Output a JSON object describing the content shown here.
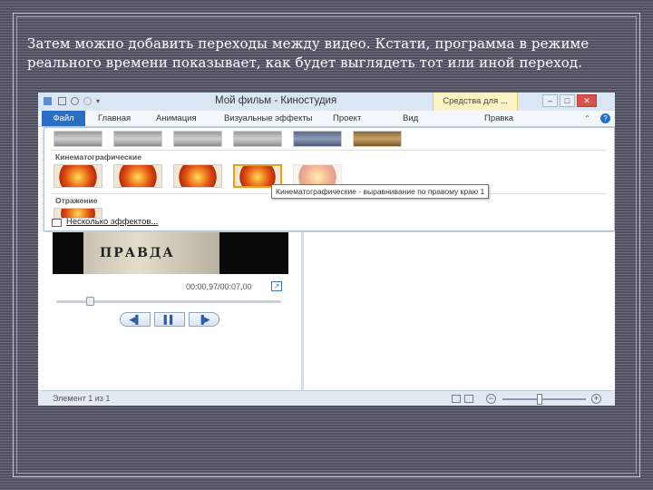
{
  "slide": {
    "caption": "Затем можно добавить переходы между видео. Кстати, программа в режиме реального времени показывает, как будет выглядеть тот или иной переход."
  },
  "window": {
    "title": "Мой фильм - Киностудия",
    "context_tab": "Средства для ...",
    "controls": {
      "minimize": "–",
      "maximize": "□",
      "close": "✕"
    }
  },
  "ribbon": {
    "tabs": [
      "Файл",
      "Главная",
      "Анимация",
      "Визуальные эффекты",
      "Проект",
      "Вид",
      "Правка"
    ],
    "help": "?"
  },
  "gallery": {
    "sections": [
      {
        "label": "Кинематографические"
      },
      {
        "label": "Отражение"
      }
    ],
    "tooltip": "Кинематографические - выравнивание по правому краю 1",
    "more_effects": "Несколько эффектов..."
  },
  "preview": {
    "newspaper_text": "ПРАВДА",
    "time": "00:00,97/00:07,00",
    "fullscreen_icon": "↗",
    "seek_progress": 0.15,
    "controls": {
      "prev": "◀▌",
      "play": "▌▌",
      "next": "▐▶"
    }
  },
  "status": {
    "text": "Элемент 1 из 1",
    "zoom_out": "−",
    "zoom_in": "+",
    "zoom_level": 0.45
  },
  "colors": {
    "file_tab": "#2b6fc4",
    "context_tab": "#fbf3c6",
    "selected_thumb": "#e3a21a",
    "close_button": "#d8514a"
  }
}
